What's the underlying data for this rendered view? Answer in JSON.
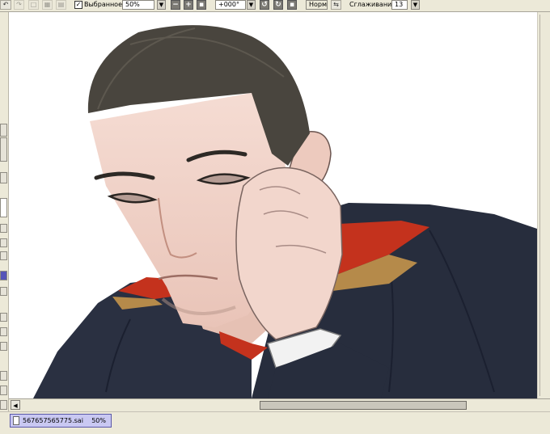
{
  "toolbar": {
    "selection_checked": true,
    "selection_label": "Выбранное",
    "zoom_value": "50%",
    "rotation_value": "+000°",
    "blend_mode": "Норм",
    "smoothing_label": "Сглаживание",
    "smoothing_value": "13"
  },
  "document": {
    "file_name": "567657565775.sai",
    "zoom": "50%"
  },
  "colors": {
    "uniform": "#272d3d",
    "collar_red": "#c4321d",
    "collar_gold": "#b58a4a",
    "skin": "#f3d6cd",
    "hair": "#49453e",
    "file_tab": "#c9c8f2"
  }
}
